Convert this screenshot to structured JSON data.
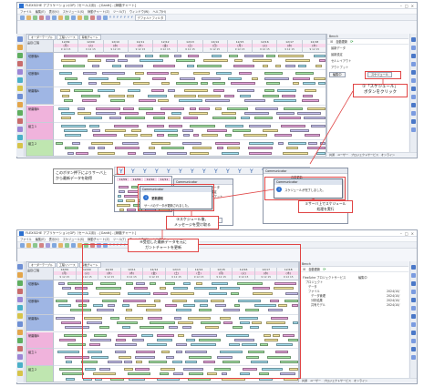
{
  "app_title": "FLEXSCHE アプリケーション(GP)（セールス用)",
  "window_title_suffix": "- [Gantt] - [稼動チャート]",
  "menu": [
    "ファイル",
    "編集(E)",
    "表示(V)",
    "スケジュール(S)",
    "稼動チャート(Z)",
    "ツール(T)",
    "ウィンドウ(W)",
    "ヘルプ(H)"
  ],
  "toolbar_filter_label": "デフォルトフィルタ",
  "gantt_tabs": [
    "オーダーテーブル",
    "工程リソース",
    "稼動チャート"
  ],
  "left_header": "品目/工程",
  "days": [
    {
      "date": "12/09",
      "dow": "(月)",
      "hours": "9 12 15"
    },
    {
      "date": "12/09",
      "dow": "(火)",
      "hours": "9 12 15"
    },
    {
      "date": "12/10",
      "dow": "(水)",
      "hours": "9 12 15"
    },
    {
      "date": "12/11",
      "dow": "(木)",
      "hours": "9 12 15"
    },
    {
      "date": "12/12",
      "dow": "(金)",
      "hours": "9 12 15"
    },
    {
      "date": "12/13",
      "dow": "(土)",
      "hours": "9 12 15"
    },
    {
      "date": "12/14",
      "dow": "(日)",
      "hours": "9 12 15"
    },
    {
      "date": "12/15",
      "dow": "(月)",
      "hours": "9 12 15"
    },
    {
      "date": "12/16",
      "dow": "(火)",
      "hours": "9 12 15"
    },
    {
      "date": "12/17",
      "dow": "(水)",
      "hours": "9 12 15"
    },
    {
      "date": "12/18",
      "dow": "(木)",
      "hours": "9 12 15"
    }
  ],
  "resources": [
    "切断機A",
    "切断機B",
    "研磨機A",
    "研磨機B",
    "組立１",
    "組立２"
  ],
  "pane": {
    "title": "Bench",
    "update_button": "自動更新",
    "items": [
      "最新データ",
      "最新設定",
      "旧版 最新設定",
      "旧版 最新データ",
      "セルレイアウト",
      "アウトプット"
    ],
    "schedule_button": "スケジュール",
    "settings_label": "編集中"
  },
  "bottom_tabs": [
    "共通",
    "ユーザー",
    "プロジェクトサービス",
    "オンライン"
  ],
  "callouts": {
    "c1_line1": "①「スケジュール」",
    "c1_line2": "ボタンをクリック",
    "c2_line1": "②サーバ上でスケジュール",
    "c2_line2": "処理を実行",
    "c3_line1": "③スケジュール後、",
    "c3_line2": "メッセージを受け取る",
    "c4_line1": "④受信した最新データを元に",
    "c4_line2": "ガントチャートを更新",
    "c5_line1": "このボタン押下によりサーバ上",
    "c5_line2": "から最新データを取得"
  },
  "dialog": {
    "title": "Communicator",
    "msg1": "更新通知",
    "msg2": "サーバのデータが更新されました。",
    "msg3": "スケジュールが完了しました。"
  },
  "tree": [
    "FlexSche プロジェクトサービス",
    "プロジェクト",
    "データ",
    "スケジュール",
    "ファイル",
    "データ管理",
    "分析結果",
    "共有モデル"
  ],
  "tree_dates": [
    "2024/10/",
    "2024/10/",
    "2024/10/",
    "2024/10/"
  ],
  "colors": {
    "pink": "#e6a6dc",
    "yellow": "#f3e6a0",
    "green": "#a8e6a8",
    "lavender": "#c9c4f0",
    "cyan": "#a6e0f0",
    "accent_red": "#e04545",
    "left_blue": "#9fb6e4"
  }
}
